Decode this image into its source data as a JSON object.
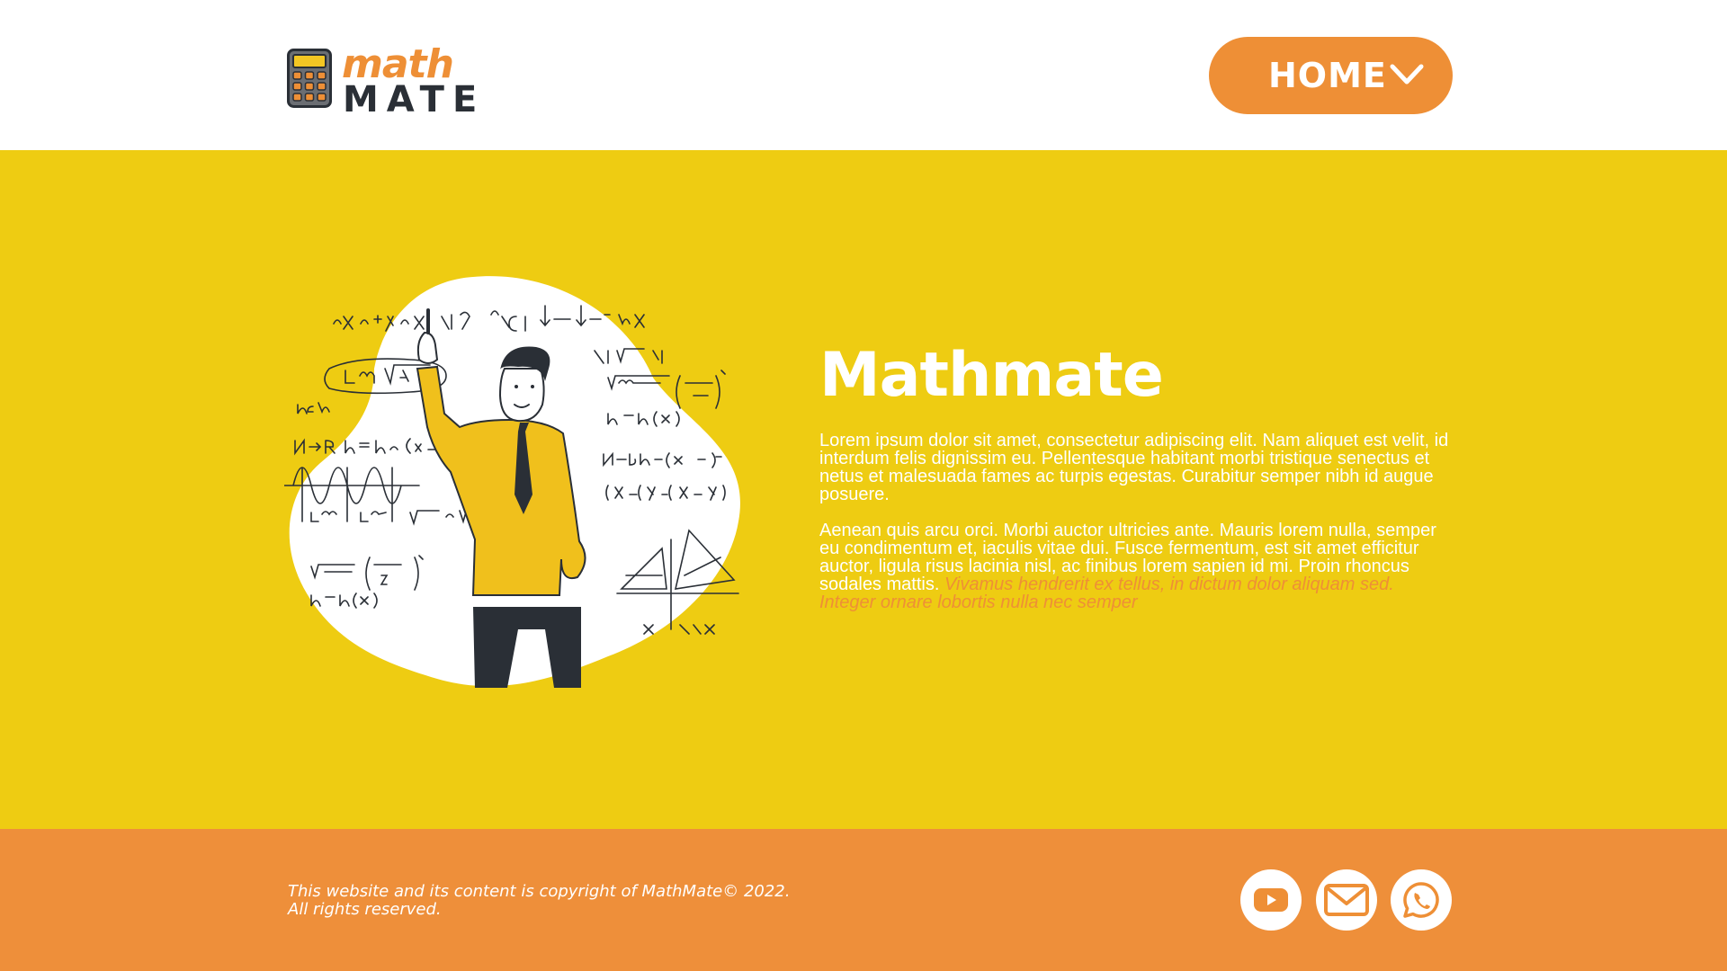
{
  "header": {
    "logo": {
      "top": "math",
      "bottom": "MATE"
    },
    "nav_button": "HOME"
  },
  "hero": {
    "title": "Mathmate",
    "paragraph1": "Lorem ipsum dolor sit amet, consectetur adipiscing elit. Nam aliquet est velit, id interdum felis dignissim eu. Pellentesque habitant morbi tristique senectus et netus et malesuada fames ac turpis egestas. Curabitur semper nibh id augue posuere.",
    "paragraph2": "Aenean quis arcu orci. Morbi auctor ultricies ante. Mauris lorem nulla, semper eu condimentum et, iaculis vitae dui. Fusce fermentum, est sit amet efficitur auctor, ligula risus lacinia nisl, ac finibus lorem sapien id mi. Proin rhoncus sodales mattis.",
    "paragraph2_highlight": "Vivamus hendrerit ex tellus, in dictum dolor aliquam sed. Integer ornare lobortis nulla nec semper"
  },
  "footer": {
    "copyright_line1": "This website and its content is copyright of MathMate© 2022.",
    "copyright_line2": "All rights reserved.",
    "social_icons": [
      "youtube-icon",
      "mail-icon",
      "whatsapp-icon"
    ]
  },
  "colors": {
    "accent": "#EE8F36",
    "hero_bg": "#EECC12",
    "dark": "#2A2F36"
  }
}
